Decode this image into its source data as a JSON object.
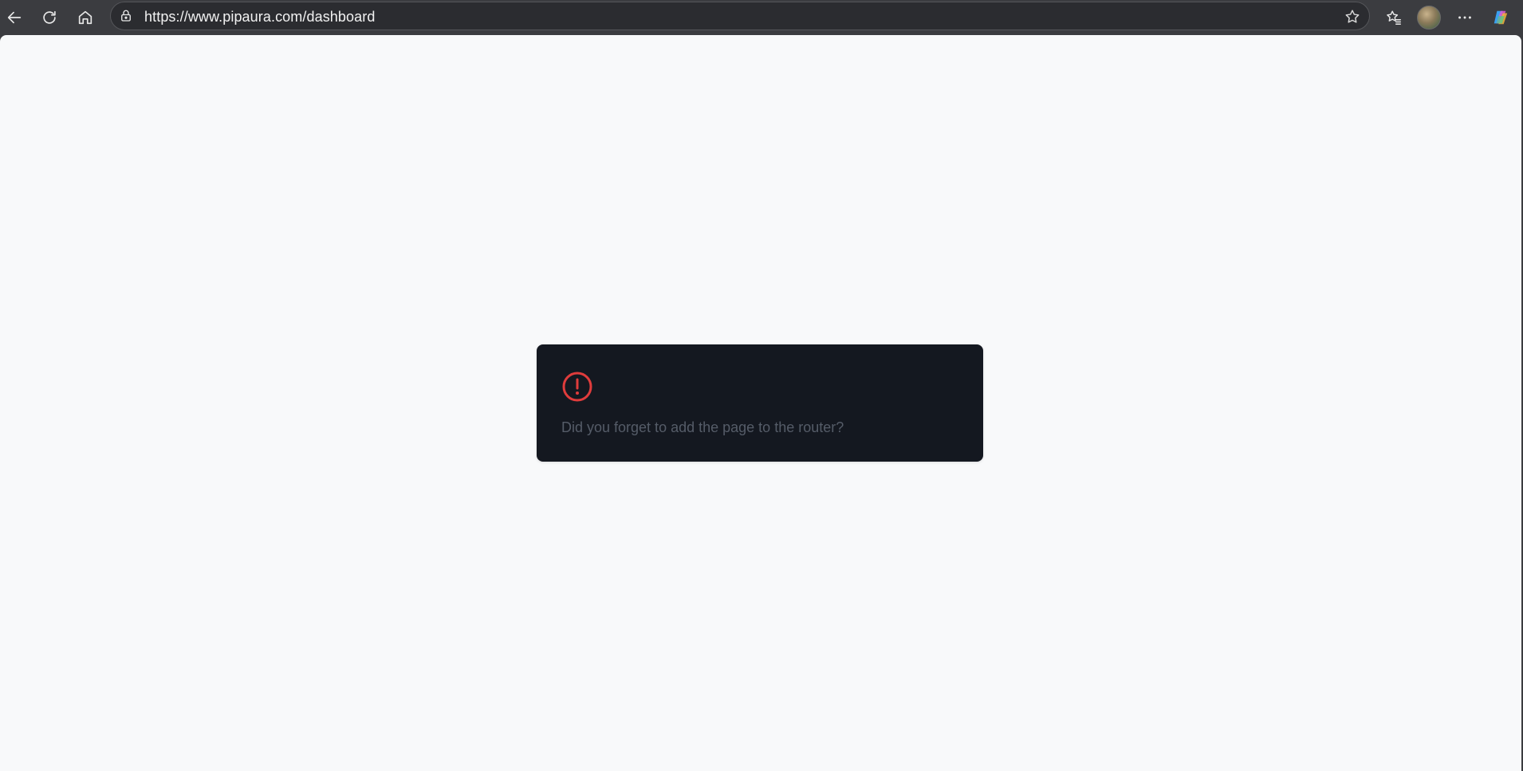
{
  "browser": {
    "url": "https://www.pipaura.com/dashboard",
    "icons": {
      "back": "back-arrow-icon",
      "reload": "reload-icon",
      "home": "home-icon",
      "lock": "lock-icon",
      "favorite": "star-icon",
      "favorites": "favorites-icon",
      "profile": "avatar",
      "more": "more-icon",
      "copilot": "copilot-icon"
    }
  },
  "error": {
    "title": "",
    "message": "Did you forget to add the page to the router?"
  },
  "colors": {
    "page_background": "#f8f9fa",
    "card_background": "#141820",
    "error_accent": "#e03c3c",
    "message_text": "#555c68"
  }
}
